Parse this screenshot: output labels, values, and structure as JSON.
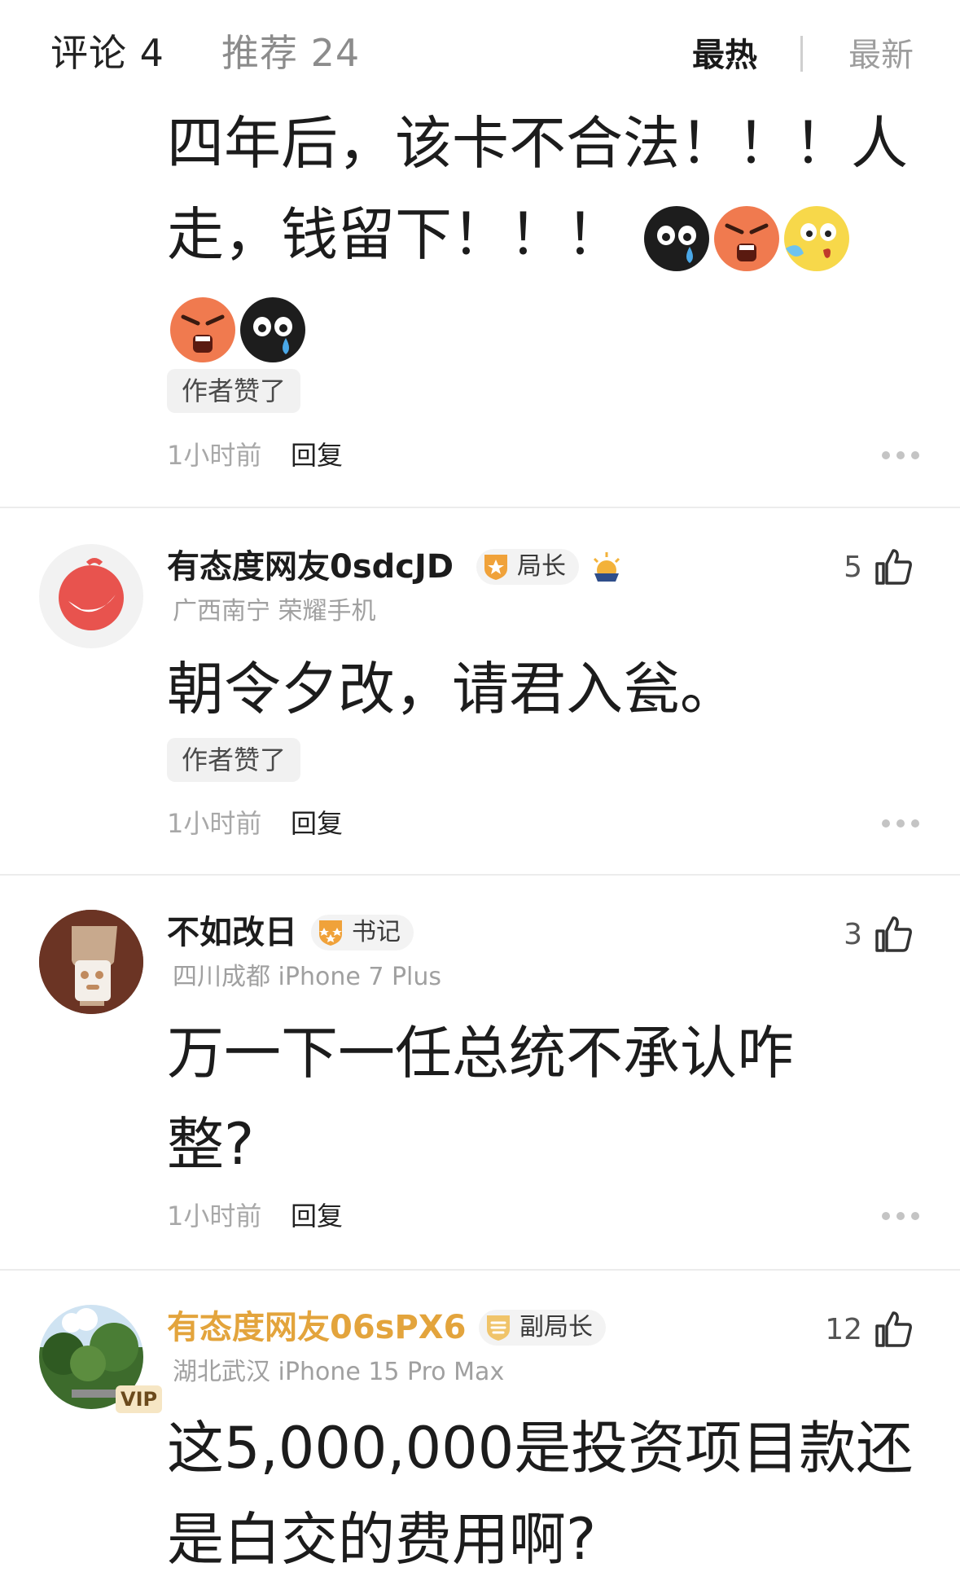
{
  "header": {
    "tab_comments": "评论 4",
    "tab_recommend": "推荐 24",
    "sort_hot": "最热",
    "sort_new": "最新"
  },
  "comments": [
    {
      "body": "四年后，该卡不合法！！！人走，钱留下！！！",
      "emojis": [
        "cry-emoji",
        "angry-emoji",
        "shocked-emoji",
        "angry-emoji",
        "cry-emoji"
      ],
      "tag": "作者赞了",
      "time": "1小时前",
      "reply": "回复"
    },
    {
      "username": "有态度网友0sdcJD",
      "badge": "局长",
      "meta": "广西南宁 荣耀手机",
      "likes": "5",
      "body": "朝令夕改，请君入瓮。",
      "tag": "作者赞了",
      "time": "1小时前",
      "reply": "回复"
    },
    {
      "username": "不如改日",
      "badge": "书记",
      "meta": "四川成都 iPhone 7 Plus",
      "likes": "3",
      "body": "万一下一任总统不承认咋整?",
      "time": "1小时前",
      "reply": "回复"
    },
    {
      "username": "有态度网友06sPX6",
      "badge": "副局长",
      "meta": "湖北武汉 iPhone 15 Pro Max",
      "likes": "12",
      "vip_label": "VIP",
      "body": "这5,000,000是投资项目款还是白交的费用啊?"
    }
  ],
  "colors": {
    "vip_name": "#e3a43c",
    "badge_gold": "#f0a23a",
    "divider": "#ececec"
  }
}
